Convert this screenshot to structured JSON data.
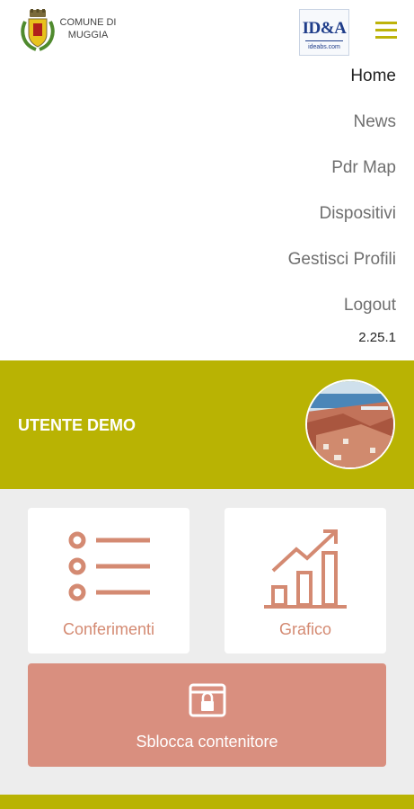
{
  "header": {
    "municipality": "COMUNE DI MUGGIA",
    "partner_logo_text": "ID&A",
    "partner_logo_site": "ideabs.com",
    "menu_icon": "hamburger-icon"
  },
  "menu": {
    "items": [
      {
        "label": "Home",
        "active": true
      },
      {
        "label": "News",
        "active": false
      },
      {
        "label": "Pdr Map",
        "active": false
      },
      {
        "label": "Dispositivi",
        "active": false
      },
      {
        "label": "Gestisci Profili",
        "active": false
      },
      {
        "label": "Logout",
        "active": false
      }
    ],
    "version": "2.25.1"
  },
  "user": {
    "name": "UTENTE DEMO"
  },
  "cards": [
    {
      "label": "Conferimenti",
      "icon": "list-icon"
    },
    {
      "label": "Grafico",
      "icon": "bar-chart-icon"
    }
  ],
  "unlock": {
    "label": "Sblocca contenitore",
    "icon": "container-lock-icon"
  },
  "colors": {
    "accent": "#b9b303",
    "card_text": "#d48a72",
    "unlock_bg": "#d98f7f"
  }
}
